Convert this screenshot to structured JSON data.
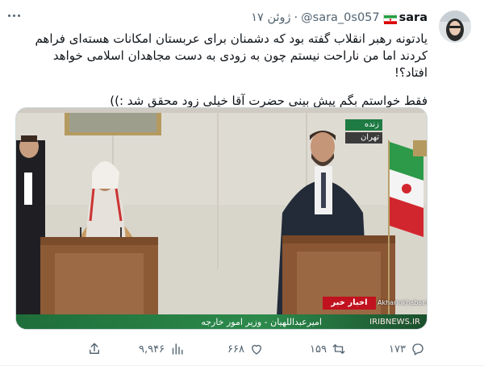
{
  "tweet": {
    "display_name": "sara",
    "handle": "@sara_0s057",
    "separator": "·",
    "time": "۱۷ ژوئن",
    "text_paragraph_1": "یادتونه رهبر انقلاب گفته بود که دشمنان برای عربستان امکانات هسته‌ای فراهم کردند اما من ناراحت نیستم چون به زودی به دست مجاهدان اسلامی خواهد افتاد؟!",
    "text_paragraph_2": "فقط خواستم بگم پیش بینی حضرت آقا خیلی زود محقق شد :))",
    "flag_icon": "iran-flag-icon"
  },
  "media": {
    "live_label": "زنده",
    "city_label": "تهران",
    "caption": "امیرعبداللهیان - وزیر امور خارجه",
    "channel_badge": "اخبار خبر",
    "watermark": "Akharinkhabar.ir",
    "site": "IRIBNEWS.IR"
  },
  "actions": {
    "views": "۹,۹۴۶",
    "likes": "۶۶۸",
    "retweets": "۱۵۹",
    "replies": "۱۷۳"
  },
  "colors": {
    "text": "#0f1419",
    "muted": "#536471",
    "border": "#cfd9de"
  }
}
